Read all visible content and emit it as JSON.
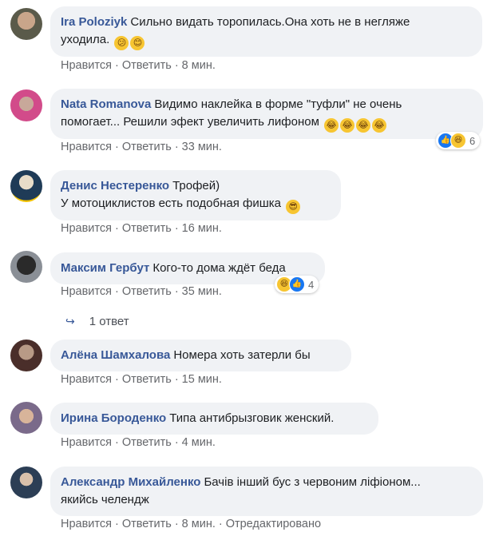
{
  "comments": [
    {
      "author": "Ira Poloziyk",
      "text_lines": [
        "Сильно видать торопилась.Она хоть не в негляже",
        "уходила."
      ],
      "emojis": [
        "😕",
        "😊"
      ],
      "time": "8 мин.",
      "like": "Нравится",
      "reply": "Ответить"
    },
    {
      "author": "Nata Romanova",
      "text_lines": [
        "Видимо наклейка в форме \"туфли\" не очень",
        "помогает... Решили эфект увеличить лифоном"
      ],
      "emojis": [
        "😂",
        "😂",
        "😂",
        "😂"
      ],
      "time": "33 мин.",
      "like": "Нравится",
      "reply": "Ответить",
      "reactions": {
        "icons": [
          "like",
          "haha"
        ],
        "count": "6"
      }
    },
    {
      "author": "Денис Нестеренко",
      "text_lines": [
        "Трофей)",
        "У мотоциклистов есть подобная фишка"
      ],
      "emojis": [
        "😎"
      ],
      "time": "16 мин.",
      "like": "Нравится",
      "reply": "Ответить"
    },
    {
      "author": "Максим Гербут",
      "text_lines": [
        "Кого-то дома ждёт беда"
      ],
      "emojis": [],
      "time": "35 мин.",
      "like": "Нравится",
      "reply": "Ответить",
      "reactions": {
        "icons": [
          "haha",
          "like"
        ],
        "count": "4"
      }
    },
    {
      "author": "Алёна Шамхалова",
      "text_lines": [
        "Номера хоть затерли бы"
      ],
      "emojis": [],
      "time": "15 мин.",
      "like": "Нравится",
      "reply": "Ответить"
    },
    {
      "author": "Ирина Бороденко",
      "text_lines": [
        "Типа антибрызговик женский."
      ],
      "emojis": [],
      "time": "4 мин.",
      "like": "Нравится",
      "reply": "Ответить"
    },
    {
      "author": "Александр Михайленко",
      "text_lines": [
        "Бачів інший бус з червоним ліфіоном...",
        "якийсь челендж"
      ],
      "emojis": [],
      "time": "8 мин.",
      "like": "Нравится",
      "reply": "Ответить",
      "edited": "Отредактировано"
    }
  ],
  "replies_link": {
    "label": "1 ответ"
  },
  "colors": {
    "author": "#385898",
    "bubble": "#f0f2f5",
    "meta": "#65676b",
    "like": "#1877f2"
  }
}
